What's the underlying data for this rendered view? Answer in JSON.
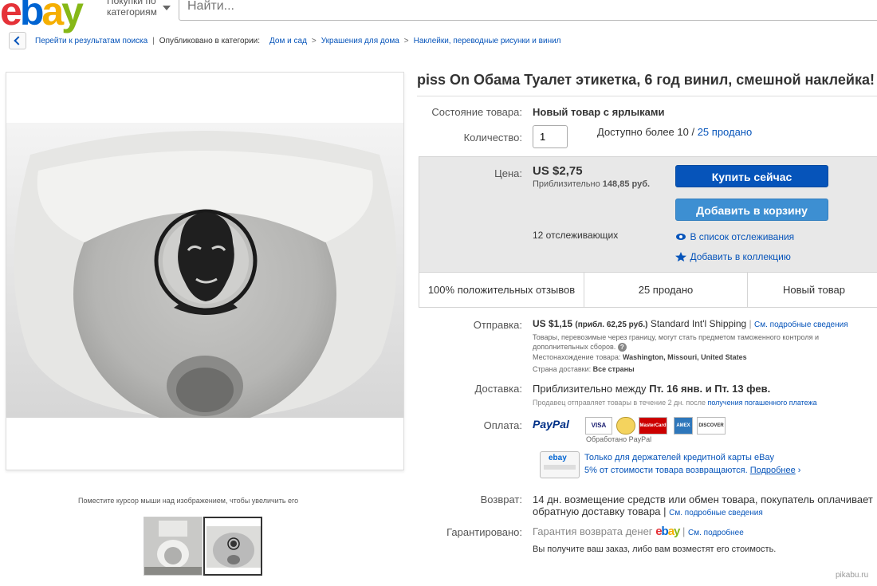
{
  "header": {
    "logo": [
      "e",
      "b",
      "a",
      "y"
    ],
    "category_button": "Покупки по категориям",
    "search_placeholder": "Найти..."
  },
  "breadcrumb": {
    "back_link": "Перейти к результатам поиска",
    "published_in": "Опубликовано в категории:",
    "items": [
      "Дом и сад",
      "Украшения для дома",
      "Наклейки, переводные рисунки и винил"
    ]
  },
  "gallery": {
    "zoom_hint": "Поместите курсор мыши над изображением, чтобы увеличить его"
  },
  "item": {
    "title": "piss On Обама Туалет этикетка, 6 год винил, смешной наклейка!",
    "condition_label": "Состояние товара:",
    "condition_value": "Новый товар с ярлыками",
    "quantity_label": "Количество:",
    "quantity_value": "1",
    "availability": "Доступно более 10 /",
    "sold_link": "25 продано"
  },
  "buybox": {
    "price_label": "Цена:",
    "price": "US $2,75",
    "approx_prefix": "Приблизительно",
    "approx_value": "148,85 руб.",
    "buy_now": "Купить сейчас",
    "add_to_cart": "Добавить в корзину",
    "watchers": "12 отслеживающих",
    "watchlist_link": "В список отслеживания",
    "collection_link": "Добавить в коллекцию",
    "stat_feedback": "100% положительных отзывов",
    "stat_sold": "25 продано",
    "stat_condition": "Новый товар"
  },
  "shipping": {
    "label": "Отправка:",
    "price": "US $1,15",
    "approx": "(прибл. 62,25 руб.)",
    "service": "Standard Int'l Shipping",
    "details_link": "См. подробные сведения",
    "customs_note": "Товары, перевозимые через границу, могут стать предметом таможенного контроля и дополнительных сборов.",
    "location_label": "Местонахождение товара:",
    "location_value": "Washington, Missouri, United States",
    "ships_to_label": "Страна доставки:",
    "ships_to_value": "Все страны"
  },
  "delivery": {
    "label": "Доставка:",
    "prefix": "Приблизительно между",
    "dates": "Пт. 16 янв. и Пт. 13 фев.",
    "note": "Продавец отправляет товары в течение 2 дн. после",
    "note_link": "получения погашенного платежа"
  },
  "payment": {
    "label": "Оплата:",
    "paypal": "PayPal",
    "processed": "Обработано PayPal",
    "cards": [
      "VISA",
      "MasterCard",
      "AMEX",
      "DISCOVER"
    ],
    "promo_line1": "Только для держателей кредитной карты eBay",
    "promo_line2": "5% от стоимости товара возвращаются.",
    "promo_link": "Подробнее"
  },
  "returns": {
    "label": "Возврат:",
    "text1": "14 дн. возмещение средств или обмен товара, покупатель оплачивает",
    "text2": "обратную доставку товара |",
    "link": "См. подробные сведения"
  },
  "guarantee": {
    "label": "Гарантировано:",
    "text": "Гарантия возврата денег",
    "link": "См. подробнее",
    "note": "Вы получите ваш заказ, либо вам возместят его стоимость."
  },
  "watermark": "pikabu.ru"
}
